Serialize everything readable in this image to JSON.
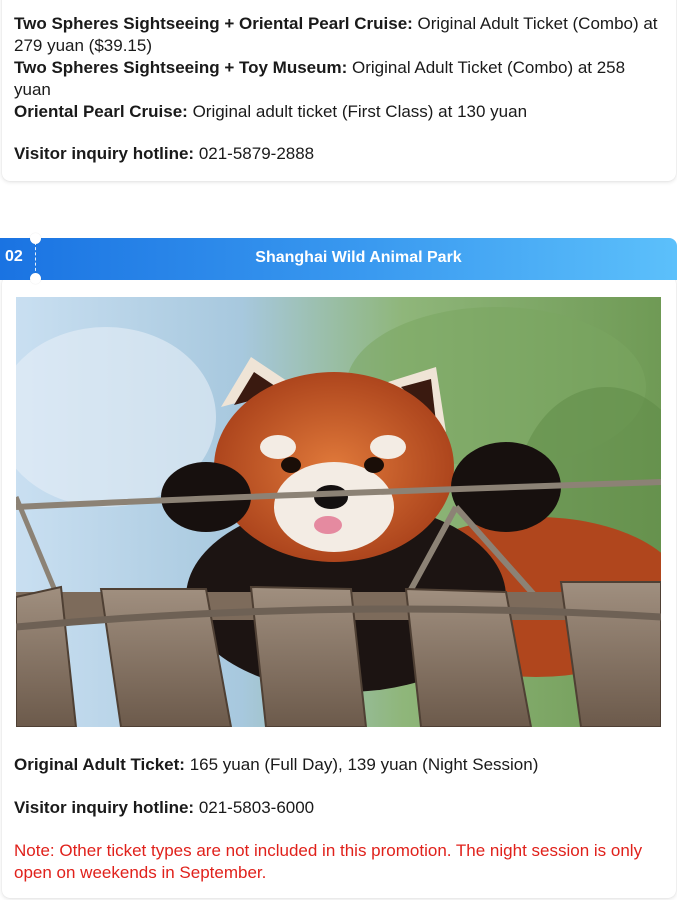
{
  "section1": {
    "items": [
      {
        "label": "Two Spheres Sightseeing + Oriental Pearl Cruise:",
        "value": " Original Adult Ticket (Combo) at 279 yuan ($39.15)"
      },
      {
        "label": "Two Spheres Sightseeing + Toy Museum:",
        "value": " Original Adult Ticket (Combo) at 258 yuan"
      },
      {
        "label": "Oriental Pearl Cruise:",
        "value": " Original adult ticket (First Class) at 130 yuan"
      }
    ],
    "hotline": {
      "label": "Visitor inquiry hotline:",
      "value": " 021-5879-2888"
    }
  },
  "section2": {
    "number": "02",
    "title": "Shanghai Wild Animal Park",
    "photo_subject": "red-panda-on-rope-bridge",
    "ticket": {
      "label": "Original Adult Ticket:",
      "value": " 165 yuan (Full Day), 139 yuan (Night Session)"
    },
    "hotline": {
      "label": "Visitor inquiry hotline:",
      "value": " 021-5803-6000"
    },
    "note": "Note: Other ticket types are not included in this promotion. The night session is only open on weekends in September."
  },
  "colors": {
    "header_start": "#1a73e2",
    "header_end": "#5cc0fb",
    "note_red": "#e0211b"
  }
}
